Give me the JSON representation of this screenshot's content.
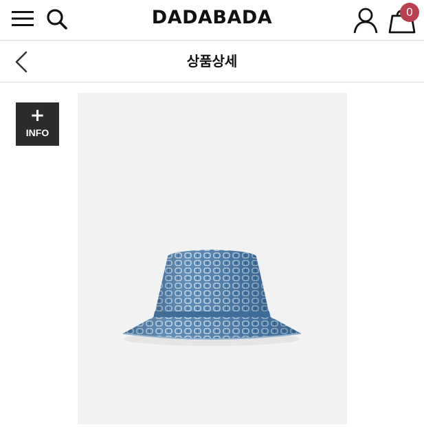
{
  "header": {
    "brand": "DADABADA",
    "cart_count": "0",
    "icons": [
      "hamburger-menu-icon",
      "search-icon",
      "user-icon",
      "shopping-bag-icon"
    ]
  },
  "subheader": {
    "title": "상품상세",
    "back_icon": "chevron-left-icon"
  },
  "info_button": {
    "plus": "+",
    "label": "INFO"
  },
  "product": {
    "image": "denim-monogram-bucket-hat",
    "colors": {
      "denim": "#4f7fab",
      "background": "#f2f2f2"
    }
  },
  "colors": {
    "badge": "#b8404f",
    "info_bg": "#2b2b2b",
    "divider": "#dcdcdc"
  }
}
